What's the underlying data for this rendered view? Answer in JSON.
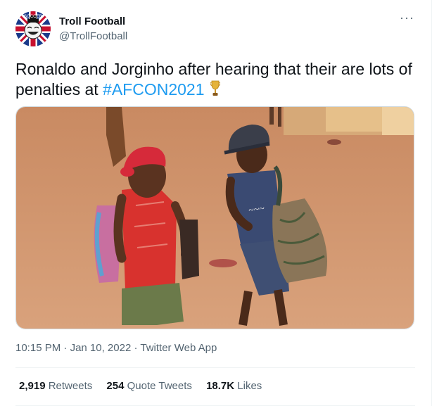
{
  "author": {
    "name": "Troll Football",
    "handle": "@TrollFootball",
    "avatar_text": "SOCCER"
  },
  "tweet": {
    "text_before": "Ronaldo and Jorginho after hearing that their are lots of penalties at ",
    "hashtag": "#AFCON2021",
    "emoji": "trophy-icon"
  },
  "meta": {
    "time": "10:15 PM",
    "sep1": " · ",
    "date": "Jan 10, 2022",
    "sep2": " · ",
    "source": "Twitter Web App"
  },
  "stats": {
    "retweets_count": "2,919",
    "retweets_label": "Retweets",
    "quotes_count": "254",
    "quotes_label": "Quote Tweets",
    "likes_count": "18.7K",
    "likes_label": "Likes"
  },
  "colors": {
    "link": "#1d9bf0",
    "secondary_text": "#536471",
    "primary_text": "#0f1419"
  },
  "more_menu": "···"
}
